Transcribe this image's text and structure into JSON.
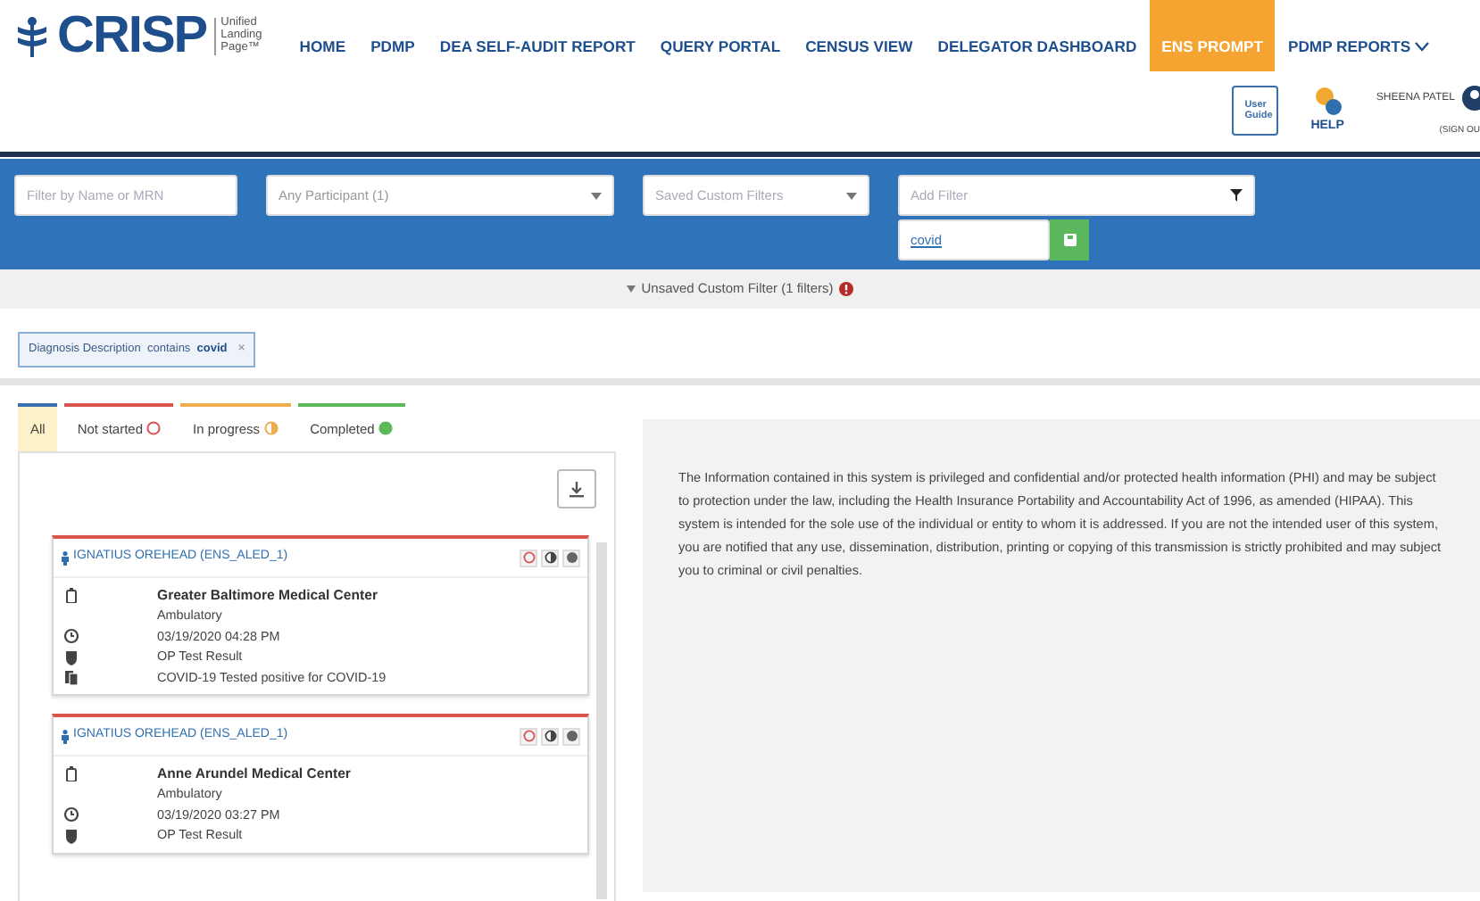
{
  "logo": {
    "name": "CRISP",
    "tagline": [
      "Unified",
      "Landing",
      "Page™"
    ]
  },
  "nav": [
    {
      "label": "HOME",
      "selected": false,
      "dropdown": false
    },
    {
      "label": "PDMP",
      "selected": false,
      "dropdown": false
    },
    {
      "label": "DEA SELF-AUDIT REPORT",
      "selected": false,
      "dropdown": false
    },
    {
      "label": "QUERY PORTAL",
      "selected": false,
      "dropdown": false
    },
    {
      "label": "CENSUS VIEW",
      "selected": false,
      "dropdown": false
    },
    {
      "label": "DELEGATOR DASHBOARD",
      "selected": false,
      "dropdown": false
    },
    {
      "label": "ENS PROMPT",
      "selected": true,
      "dropdown": false
    },
    {
      "label": "PDMP REPORTS",
      "selected": false,
      "dropdown": true
    }
  ],
  "tools": {
    "guide_text": "User Guide",
    "help": "HELP"
  },
  "user": {
    "name": "SHEENA PATEL",
    "sign_out": "(SIGN OU"
  },
  "filters": {
    "name_field": {
      "placeholder": "Filter by Name or MRN"
    },
    "participant": {
      "value": "Any Participant (1)"
    },
    "saved": {
      "placeholder": "Saved Custom Filters"
    },
    "add_filter": {
      "placeholder": "Add Filter"
    },
    "filter_value": "covid"
  },
  "unsaved_bar": {
    "text": "Unsaved Custom Filter (1 filters)"
  },
  "chip": {
    "text": "Diagnosis Description  contains  **covid**",
    "close": "×"
  },
  "status_tabs": [
    {
      "label": "All",
      "selected": true,
      "color": "#3a6fb0",
      "kind": "none"
    },
    {
      "label": "Not started",
      "selected": false,
      "color": "#d9534f",
      "kind": "empty"
    },
    {
      "label": "In progress",
      "selected": false,
      "color": "#f0ad4e",
      "kind": "half"
    },
    {
      "label": "Completed",
      "selected": false,
      "color": "#5cb85c",
      "kind": "full"
    }
  ],
  "cards": [
    {
      "patient": "IGNATIUS OREHEAD (ENS_ALED_1)",
      "facility": "Greater Baltimore Medical Center",
      "setting": "Ambulatory",
      "datetime": "03/19/2020 04:28 PM",
      "event": "OP Test Result",
      "diagnosis": "COVID-19 Tested positive for COVID-19"
    },
    {
      "patient": "IGNATIUS OREHEAD (ENS_ALED_1)",
      "facility": "Anne Arundel Medical Center",
      "setting": "Ambulatory",
      "datetime": "03/19/2020 03:27 PM",
      "event": "OP Test Result"
    }
  ],
  "notice": "The Information contained in this system is privileged and confidential and/or protected health information (PHI) and may be subject to protection under the law, including the Health Insurance Portability and Accountability Act of 1996, as amended (HIPAA). This system is intended for the sole use of the individual or entity to whom it is addressed. If you are not the intended user of this system, you are notified that any use, dissemination, distribution, printing or copying of this transmission is strictly prohibited and may subject you to criminal or civil penalties."
}
